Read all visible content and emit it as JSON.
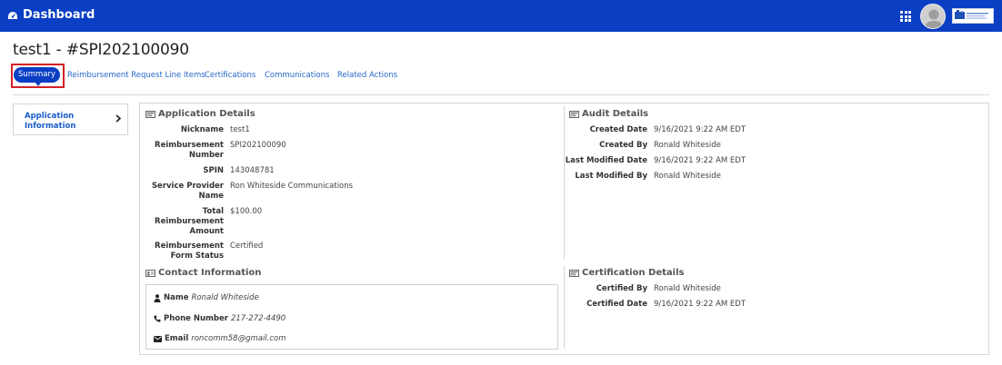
{
  "header": {
    "brand": "Dashboard"
  },
  "page": {
    "title": "test1 - #SPI202100090"
  },
  "tabs": [
    {
      "label": "Summary"
    },
    {
      "label": "Reimbursement Request Line Items"
    },
    {
      "label": "Certifications"
    },
    {
      "label": "Communications"
    },
    {
      "label": "Related Actions"
    }
  ],
  "sidenav": {
    "item": "Application Information"
  },
  "application_details": {
    "heading": "Application Details",
    "rows": [
      {
        "label": "Nickname",
        "value": "test1"
      },
      {
        "label": "Reimbursement Number",
        "value": "SPI202100090"
      },
      {
        "label": "SPIN",
        "value": "143048781"
      },
      {
        "label": "Service Provider Name",
        "value": "Ron Whiteside Communications"
      },
      {
        "label": "Total Reimbursement Amount",
        "value": "$100.00"
      },
      {
        "label": "Reimbursement Form Status",
        "value": "Certified"
      }
    ]
  },
  "audit_details": {
    "heading": "Audit Details",
    "rows": [
      {
        "label": "Created Date",
        "value": "9/16/2021 9:22 AM EDT"
      },
      {
        "label": "Created By",
        "value": "Ronald Whiteside"
      },
      {
        "label": "Last Modified Date",
        "value": "9/16/2021 9:22 AM EDT"
      },
      {
        "label": "Last Modified By",
        "value": "Ronald Whiteside"
      }
    ]
  },
  "contact_information": {
    "heading": "Contact Information",
    "name_label": "Name",
    "name": "Ronald Whiteside",
    "phone_label": "Phone Number",
    "phone": "217-272-4490",
    "email_label": "Email",
    "email": "roncomm58@gmail.com"
  },
  "certification_details": {
    "heading": "Certification Details",
    "rows": [
      {
        "label": "Certified By",
        "value": "Ronald Whiteside"
      },
      {
        "label": "Certified Date",
        "value": "9/16/2021 9:22 AM EDT"
      }
    ]
  },
  "icons": {
    "brand": "dashboard-icon",
    "apps": "grid-icon",
    "user": "avatar",
    "section": "id-card-icon",
    "name": "user-icon",
    "phone": "phone-icon",
    "email": "envelope-icon"
  },
  "colors": {
    "header": "#0a3fc4",
    "link": "#2767c9",
    "highlight": "#d32027"
  }
}
